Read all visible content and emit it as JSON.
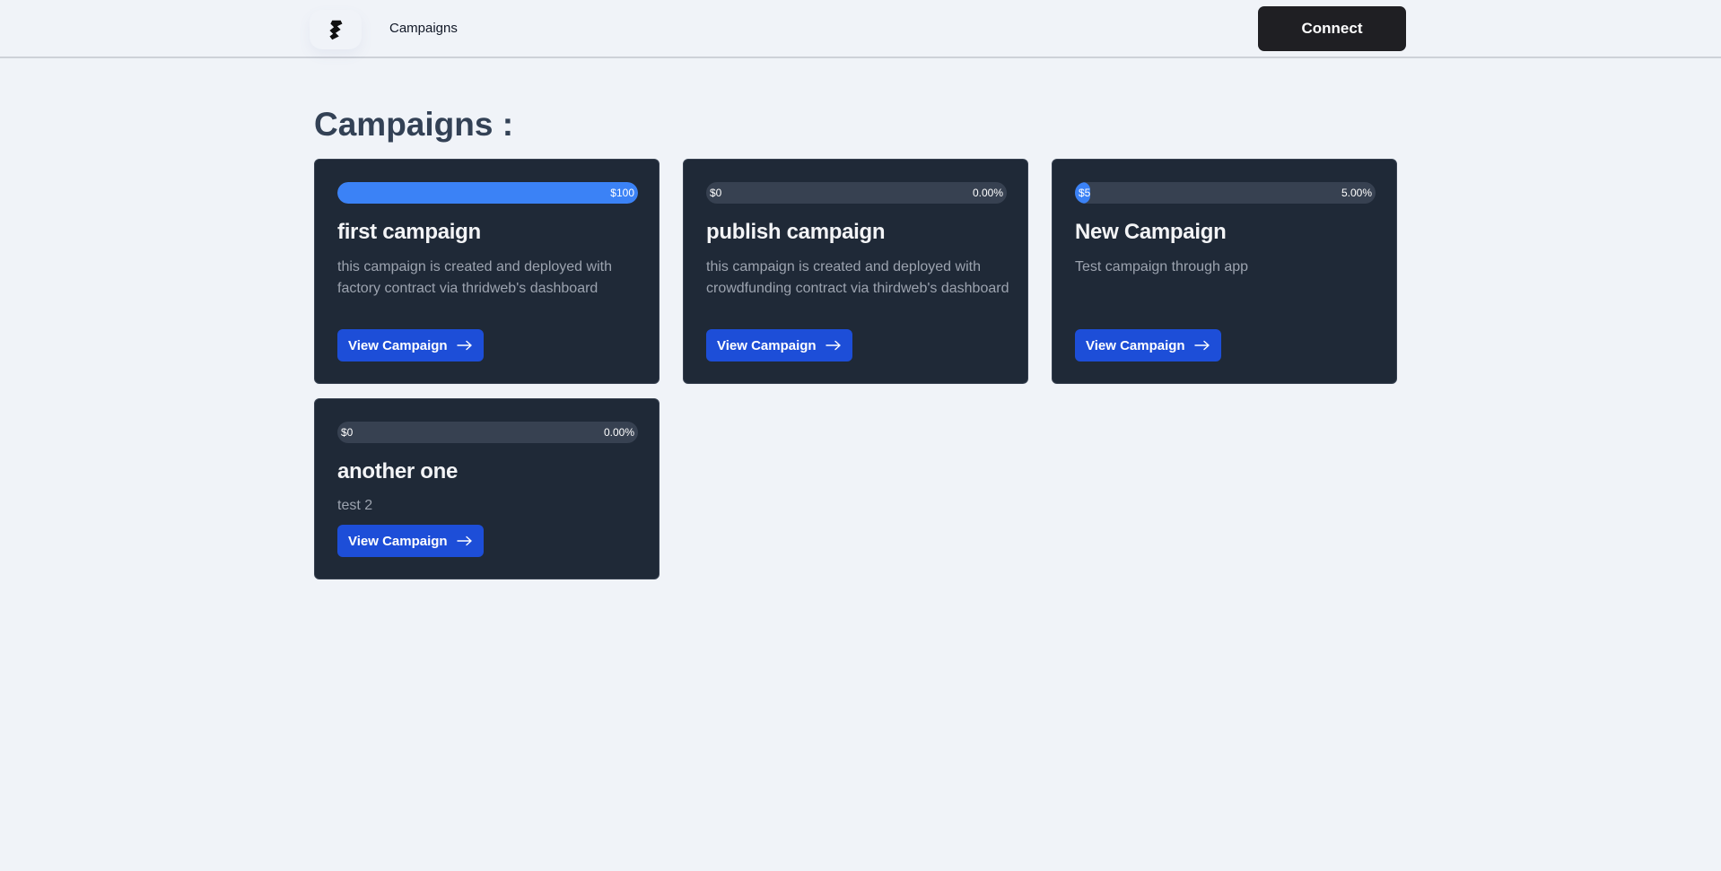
{
  "nav": {
    "logo_icon": "thirdweb-logo-icon",
    "link_label": "Campaigns",
    "connect_label": "Connect"
  },
  "page": {
    "title": "Campaigns :"
  },
  "campaigns": [
    {
      "name": "first campaign",
      "description": "this campaign is created and deployed with factory contract via thridweb's dashboard",
      "amount": "$100",
      "percent": "",
      "progress_fraction": 1.0,
      "button_label": "View Campaign"
    },
    {
      "name": "publish campaign",
      "description": "this campaign is created and deployed with crowdfunding contract via thirdweb's dashboard",
      "amount": "$0",
      "percent": "0.00%",
      "progress_fraction": 0.0,
      "button_label": "View Campaign"
    },
    {
      "name": "New Campaign",
      "description": "Test campaign through app",
      "amount": "$5",
      "percent": "5.00%",
      "progress_fraction": 0.05,
      "button_label": "View Campaign"
    },
    {
      "name": "another one",
      "description": "test 2",
      "amount": "$0",
      "percent": "0.00%",
      "progress_fraction": 0.0,
      "button_label": "View Campaign"
    }
  ],
  "colors": {
    "accent": "#3b82f6",
    "button": "#1d4ed8",
    "card_bg": "#1f2937",
    "page_bg": "#f0f3f8"
  },
  "icons": {
    "view_arrow": "arrow-right-icon"
  }
}
